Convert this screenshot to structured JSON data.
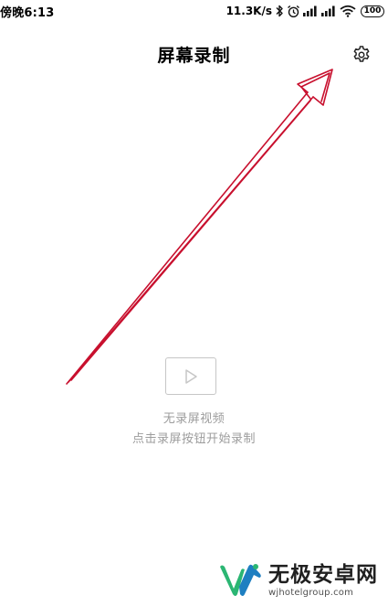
{
  "status_bar": {
    "time": "傍晚6:13",
    "net_speed": "11.3K/s",
    "battery": "100",
    "icons": [
      "bluetooth-icon",
      "alarm-icon",
      "signal-icon",
      "signal-icon",
      "wifi-icon",
      "battery-icon"
    ]
  },
  "header": {
    "title": "屏幕录制",
    "settings_icon": "gear-icon"
  },
  "empty_state": {
    "icon": "video-play-icon",
    "title": "无录屏视频",
    "hint": "点击录屏按钮开始录制"
  },
  "annotation": {
    "color": "#c8102e",
    "type": "arrow-to-settings"
  },
  "watermark": {
    "name": "无极安卓网",
    "url": "wjhotelgroup.com",
    "logo_colors": [
      "#2bb673",
      "#1e7fc1"
    ]
  }
}
